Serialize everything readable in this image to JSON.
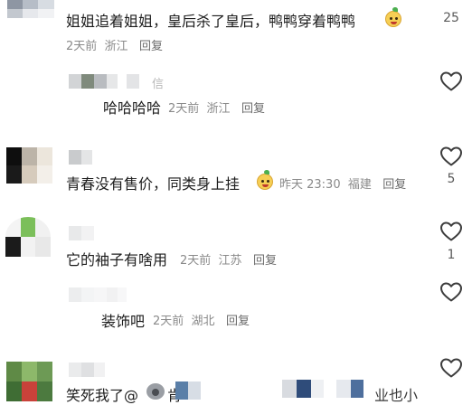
{
  "comments": [
    {
      "text": "姐姐追着姐姐，皇后杀了皇后，鸭鸭穿着鸭鸭",
      "time": "2天前",
      "location": "浙江",
      "reply": "回复",
      "likes": "25"
    },
    {
      "name_fragment": "信",
      "text": "哈哈哈哈",
      "time": "2天前",
      "location": "浙江",
      "reply": "回复"
    },
    {
      "text": "青春没有售价，同类身上挂",
      "time": "昨天 23:30",
      "location": "福建",
      "reply": "回复",
      "likes": "5"
    },
    {
      "text": "它的袖子有啥用",
      "time": "2天前",
      "location": "江苏",
      "reply": "回复",
      "likes": "1"
    },
    {
      "text": "装饰吧",
      "time": "2天前",
      "location": "湖北",
      "reply": "回复"
    },
    {
      "text": "笑死我了@",
      "mention_fragment": "肯",
      "trailing_fragment": "业也小"
    }
  ],
  "icons": {
    "like": "heart-outline-icon",
    "emoji": "smiley-emoji-icon",
    "koala": "koala-emoji-icon"
  },
  "colors": {
    "text": "#1c1c1c",
    "meta": "#8a8a8a",
    "likes": "#5a5a5a",
    "emoji": "#f6cf55"
  }
}
